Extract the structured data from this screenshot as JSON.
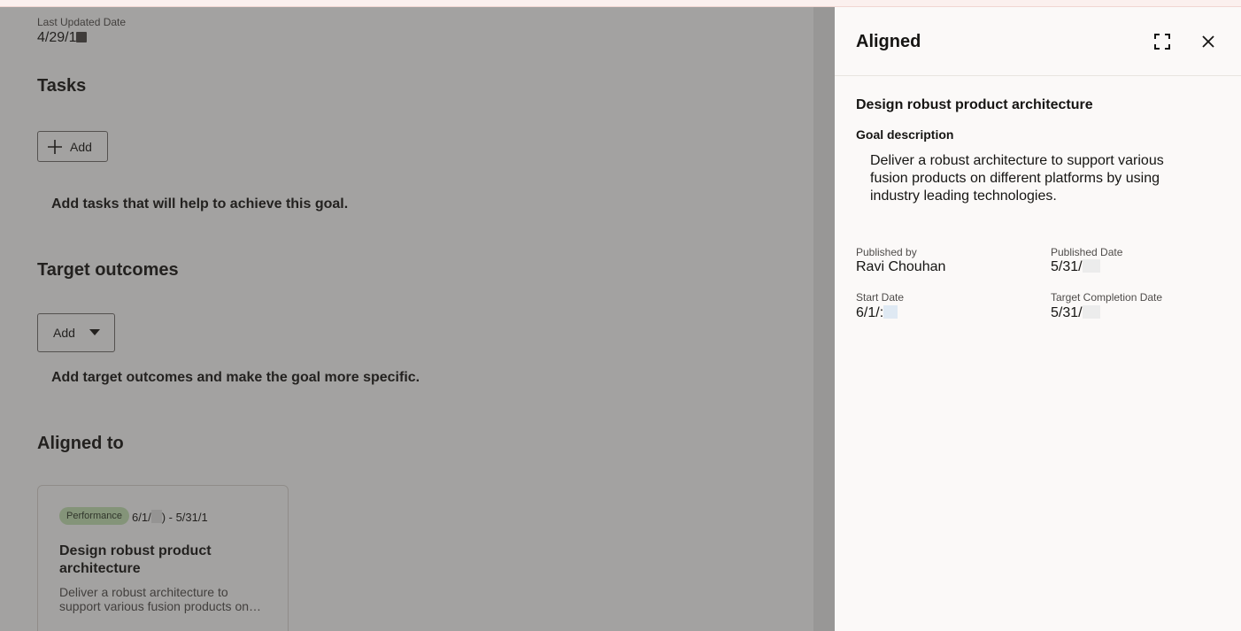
{
  "page": {
    "last_updated_label": "Last Updated Date",
    "last_updated_value": "4/29/1",
    "tasks_title": "Tasks",
    "tasks_add_label": "Add",
    "tasks_helper": "Add tasks that will help to achieve this goal.",
    "outcomes_title": "Target outcomes",
    "outcomes_add_label": "Add",
    "outcomes_helper": "Add target outcomes and make the goal more specific.",
    "aligned_title": "Aligned to",
    "card": {
      "badge": "Performance",
      "date_start": "6/1/",
      "date_end": ") - 5/31/1",
      "title": "Design robust product architecture",
      "description": "Deliver a robust architecture to support various fusion products on…"
    }
  },
  "drawer": {
    "title": "Aligned",
    "goal_title": "Design robust product architecture",
    "goal_description_label": "Goal description",
    "goal_description": "Deliver a robust architecture to support various fusion products on different platforms by using industry leading technologies.",
    "published_by_label": "Published by",
    "published_by_value": "Ravi Chouhan",
    "published_date_label": "Published Date",
    "published_date_value": "5/31/",
    "start_date_label": "Start Date",
    "start_date_value": "6/1/:",
    "target_completion_label": "Target Completion Date",
    "target_completion_value": "5/31/"
  },
  "icons": {
    "expand": "expand-icon",
    "close": "close-icon",
    "plus": "plus-icon",
    "caret": "caret-down-icon"
  },
  "colors": {
    "badge_bg": "#c7e6b7",
    "overlay": "#34302e",
    "drawer_bg": "#fbf9f8"
  }
}
